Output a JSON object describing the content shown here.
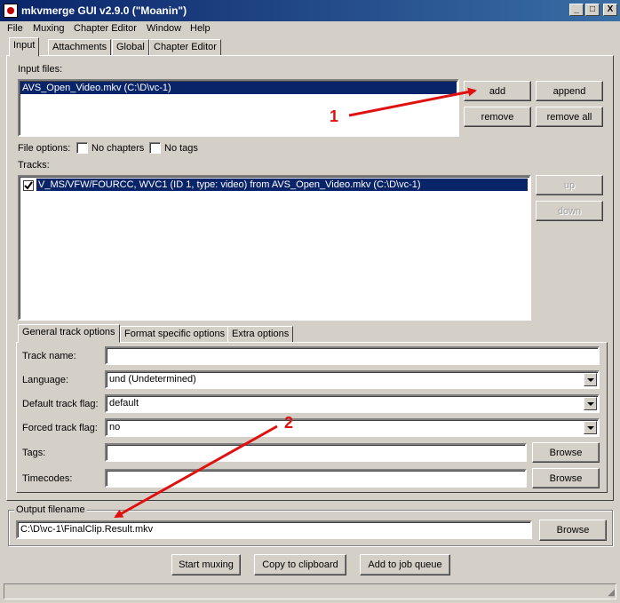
{
  "window": {
    "title": "mkvmerge GUI v2.9.0 (\"Moanin\")",
    "controls": [
      "_",
      "□",
      "X"
    ]
  },
  "menu": [
    "File",
    "Muxing",
    "Chapter Editor",
    "Window",
    "Help"
  ],
  "tabs": [
    "Input",
    "Attachments",
    "Global",
    "Chapter Editor"
  ],
  "input": {
    "input_files_label": "Input files:",
    "files": [
      "AVS_Open_Video.mkv (C:\\D\\vc-1)"
    ],
    "buttons": {
      "add": "add",
      "append": "append",
      "remove": "remove",
      "remove_all": "remove all"
    },
    "file_options_label": "File options:",
    "no_chapters_label": "No chapters",
    "no_tags_label": "No tags",
    "tracks_label": "Tracks:",
    "tracks": [
      {
        "checked": true,
        "label": "V_MS/VFW/FOURCC, WVC1 (ID 1, type: video) from AVS_Open_Video.mkv (C:\\D\\vc-1)"
      }
    ],
    "up_label": "up",
    "down_label": "down"
  },
  "track_tabs": [
    "General track options",
    "Format specific options",
    "Extra options"
  ],
  "track_options": {
    "track_name_label": "Track name:",
    "track_name_value": "",
    "language_label": "Language:",
    "language_value": "und (Undetermined)",
    "default_flag_label": "Default track flag:",
    "default_flag_value": "default",
    "forced_flag_label": "Forced track flag:",
    "forced_flag_value": "no",
    "tags_label": "Tags:",
    "tags_value": "",
    "timecodes_label": "Timecodes:",
    "timecodes_value": "",
    "browse_label": "Browse"
  },
  "output": {
    "group_label": "Output filename",
    "value": "C:\\D\\vc-1\\FinalClip.Result.mkv",
    "browse_label": "Browse"
  },
  "actions": {
    "start_muxing": "Start muxing",
    "copy_clipboard": "Copy to clipboard",
    "add_job_queue": "Add to job queue"
  },
  "annotations": {
    "one": "1",
    "two": "2",
    "color": "#e01010"
  }
}
